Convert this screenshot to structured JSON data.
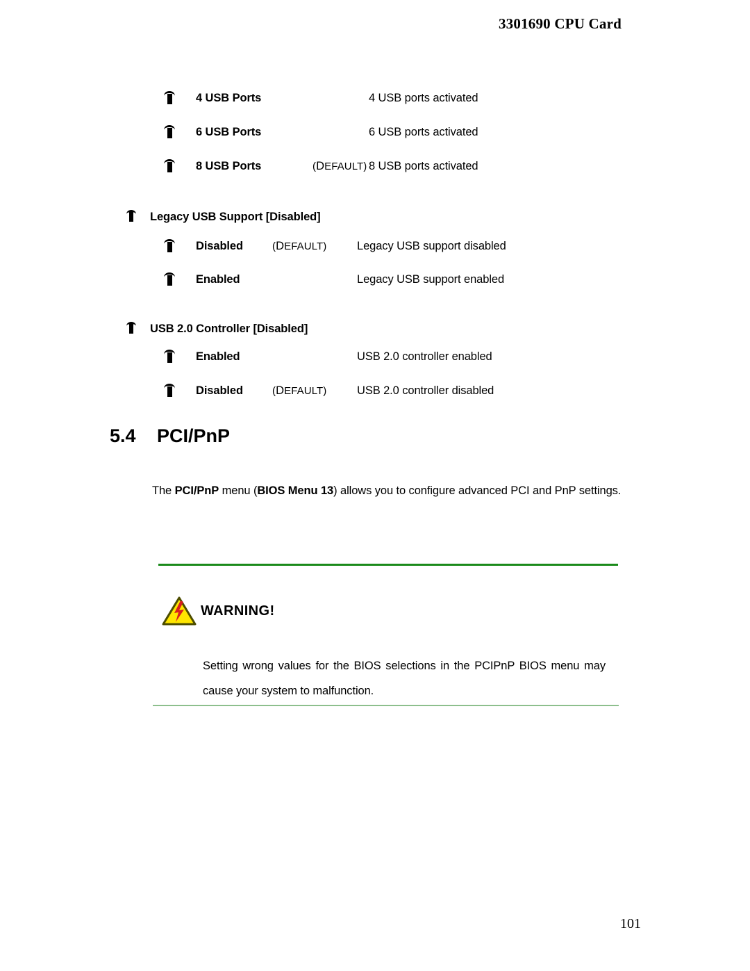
{
  "header": {
    "running_title": "3301690 CPU Card"
  },
  "usb_ports_options": [
    {
      "name": "4 USB Ports",
      "default": "",
      "description": "4 USB ports activated"
    },
    {
      "name": "6 USB Ports",
      "default": "",
      "description": "6 USB ports activated"
    },
    {
      "name": "8 USB Ports",
      "default": "(DEFAULT)",
      "description": "8 USB ports activated"
    }
  ],
  "legacy_usb": {
    "heading": "Legacy USB Support [Disabled]",
    "options": [
      {
        "name": "Disabled",
        "default": "(DEFAULT)",
        "description": "Legacy USB support disabled"
      },
      {
        "name": "Enabled",
        "default": "",
        "description": "Legacy USB support enabled"
      }
    ]
  },
  "usb20_controller": {
    "heading": "USB 2.0 Controller [Disabled]",
    "options": [
      {
        "name": "Enabled",
        "default": "",
        "description": "USB 2.0 controller enabled"
      },
      {
        "name": "Disabled",
        "default": "(DEFAULT)",
        "description": "USB 2.0 controller disabled"
      }
    ]
  },
  "section": {
    "number": "5.4",
    "title": "PCI/PnP",
    "paragraph": {
      "part1": "The ",
      "bold1": "PCI/PnP",
      "part2": " menu (",
      "bold2": "BIOS Menu 13",
      "part3": ") allows you to configure advanced PCI and PnP settings."
    }
  },
  "warning": {
    "title": "WARNING!",
    "text": "Setting wrong values for the BIOS selections in the PCIPnP BIOS menu may cause your system to malfunction.",
    "icon": "warning-triangle-icon",
    "rule_top_color": "#1a8a1a",
    "rule_bottom_color": "#8dbf8d",
    "triangle_fill": "#ffe600",
    "triangle_stroke": "#4d4d00",
    "bolt_color": "#d81e1e"
  },
  "footer": {
    "page_number": "101"
  }
}
